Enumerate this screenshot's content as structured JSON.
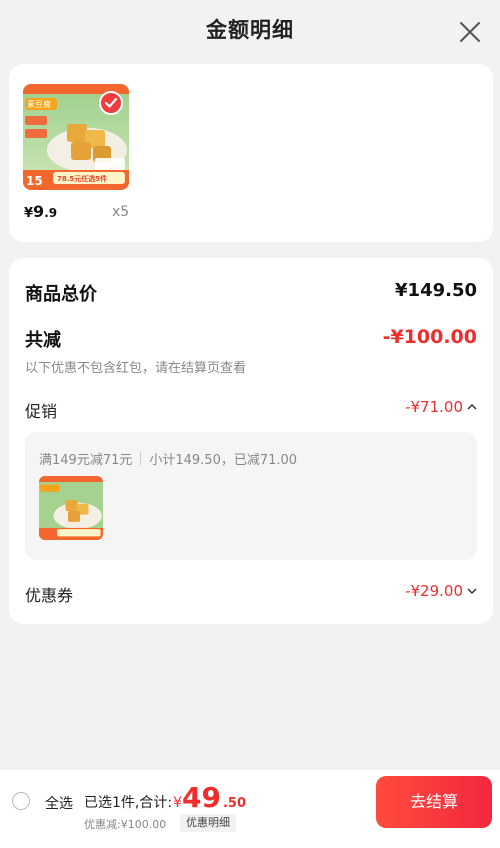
{
  "header": {
    "title": "金额明细"
  },
  "product": {
    "image_label": "product-image",
    "price_symbol": "¥",
    "price_int": "9",
    "price_dec": ".9",
    "quantity": "x5",
    "image_text": {
      "tag": "素豆腐",
      "price_tag": "15",
      "promo": "78.5元任选5件"
    }
  },
  "summary": {
    "total_label": "商品总价",
    "total_value": "¥149.50",
    "reduce_label": "共减",
    "reduce_value": "-¥100.00",
    "note": "以下优惠不包含红包，请在结算页查看",
    "promo_label": "促销",
    "promo_value": "-¥71.00",
    "promo_rule": "满149元减71元",
    "promo_subtotal": "小计149.50，已减71.00",
    "coupon_label": "优惠券",
    "coupon_value": "-¥29.00"
  },
  "footer": {
    "select_all": "全选",
    "selected_summary": "已选1件,合计:",
    "currency": "¥",
    "total_int": "49",
    "total_dec": ".50",
    "discount_text": "优惠减:¥100.00",
    "detail_button": "优惠明细",
    "checkout_button": "去结算"
  },
  "colors": {
    "accent": "#f02d2d",
    "background": "#f2f2f2"
  }
}
